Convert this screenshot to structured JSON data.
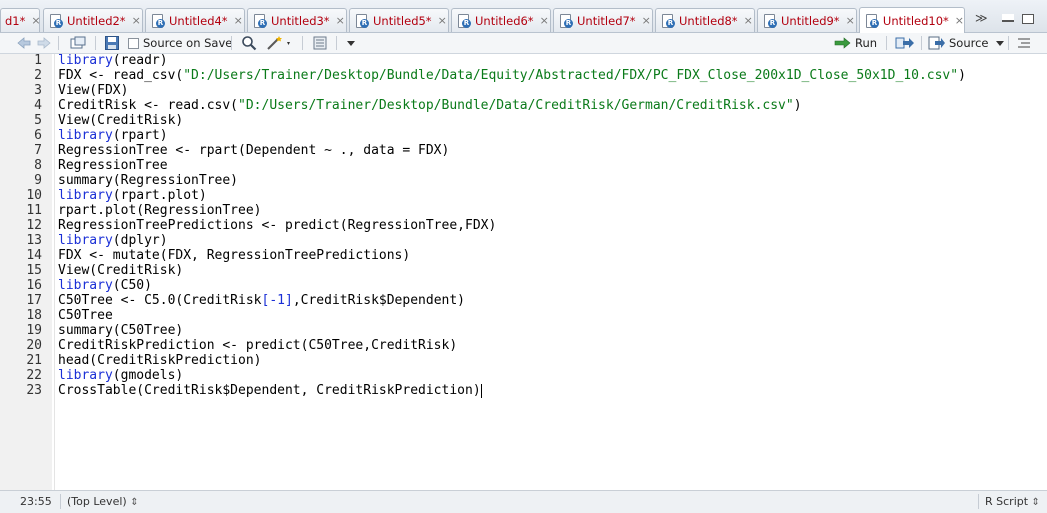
{
  "tabs": [
    {
      "label": "d1*",
      "active": false
    },
    {
      "label": "Untitled2*",
      "active": false
    },
    {
      "label": "Untitled4*",
      "active": false
    },
    {
      "label": "Untitled3*",
      "active": false
    },
    {
      "label": "Untitled5*",
      "active": false
    },
    {
      "label": "Untitled6*",
      "active": false
    },
    {
      "label": "Untitled7*",
      "active": false
    },
    {
      "label": "Untitled8*",
      "active": false
    },
    {
      "label": "Untitled9*",
      "active": false
    },
    {
      "label": "Untitled10*",
      "active": true
    }
  ],
  "tab_close_glyph": "×",
  "tab_overflow_glyph": "≫",
  "toolbar": {
    "source_on_save": "Source on Save",
    "run": "Run",
    "source": "Source"
  },
  "code_lines": [
    {
      "n": "1",
      "t": "library(readr)"
    },
    {
      "n": "2",
      "t": "FDX <- read_csv(\"D:/Users/Trainer/Desktop/Bundle/Data/Equity/Abstracted/FDX/PC_FDX_Close_200x1D_Close_50x1D_10.csv\")"
    },
    {
      "n": "3",
      "t": "View(FDX)"
    },
    {
      "n": "4",
      "t": "CreditRisk <- read.csv(\"D:/Users/Trainer/Desktop/Bundle/Data/CreditRisk/German/CreditRisk.csv\")"
    },
    {
      "n": "5",
      "t": "View(CreditRisk)"
    },
    {
      "n": "6",
      "t": "library(rpart)"
    },
    {
      "n": "7",
      "t": "RegressionTree <- rpart(Dependent ~ ., data = FDX)"
    },
    {
      "n": "8",
      "t": "RegressionTree"
    },
    {
      "n": "9",
      "t": "summary(RegressionTree)"
    },
    {
      "n": "10",
      "t": "library(rpart.plot)"
    },
    {
      "n": "11",
      "t": "rpart.plot(RegressionTree)"
    },
    {
      "n": "12",
      "t": "RegressionTreePredictions <- predict(RegressionTree,FDX)"
    },
    {
      "n": "13",
      "t": "library(dplyr)"
    },
    {
      "n": "14",
      "t": "FDX <- mutate(FDX, RegressionTreePredictions)"
    },
    {
      "n": "15",
      "t": "View(CreditRisk)"
    },
    {
      "n": "16",
      "t": "library(C50)"
    },
    {
      "n": "17",
      "t": "C50Tree <- C5.0(CreditRisk[-1],CreditRisk$Dependent)"
    },
    {
      "n": "18",
      "t": "C50Tree"
    },
    {
      "n": "19",
      "t": "summary(C50Tree)"
    },
    {
      "n": "20",
      "t": "CreditRiskPrediction <- predict(C50Tree,CreditRisk)"
    },
    {
      "n": "21",
      "t": "head(CreditRiskPrediction)"
    },
    {
      "n": "22",
      "t": "library(gmodels)"
    },
    {
      "n": "23",
      "t": "CrossTable(CreditRisk$Dependent, CreditRiskPrediction)"
    }
  ],
  "status": {
    "position": "23:55",
    "scope": "(Top Level)",
    "file_type": "R Script",
    "updown_glyph": "⇕"
  },
  "icons": [
    "r-file-icon",
    "back-arrow-icon",
    "forward-arrow-icon",
    "show-in-window-icon",
    "save-icon",
    "search-icon",
    "magic-wand-icon",
    "compile-report-icon",
    "run-arrow-icon",
    "rerun-icon",
    "source-icon",
    "outline-icon"
  ],
  "colors": {
    "keyword": "#1a2fd6",
    "string": "#0a7a19",
    "tab_text": "#b2000f"
  }
}
